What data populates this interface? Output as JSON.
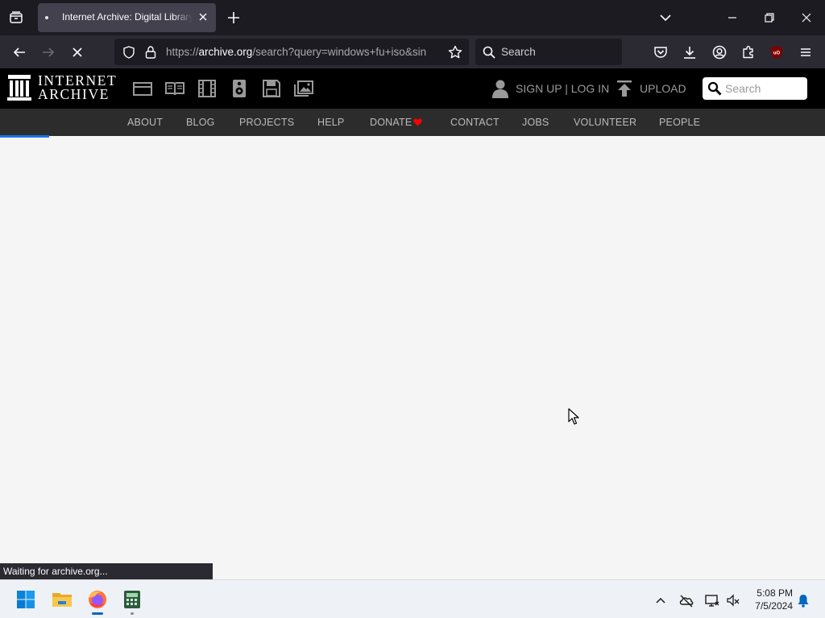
{
  "browser": {
    "tab_title": "Internet Archive: Digital Library of Free & Borrowable Books, Movies, Music & Wayback Machine",
    "url_prefix": "https://",
    "url_host": "archive.org",
    "url_rest": "/search?query=windows+fu+iso&sin",
    "search_placeholder": "Search",
    "status_text": "Waiting for archive.org...",
    "page_loading": true
  },
  "ia": {
    "logo_line1": "INTERNET",
    "logo_line2": "ARCHIVE",
    "signup_label": "SIGN UP | LOG IN",
    "upload_label": "UPLOAD",
    "search_placeholder": "Search",
    "nav": [
      "ABOUT",
      "BLOG",
      "PROJECTS",
      "HELP",
      "DONATE",
      "CONTACT",
      "JOBS",
      "VOLUNTEER",
      "PEOPLE"
    ],
    "donate_heart_color": "#ff0000"
  },
  "taskbar": {
    "time": "5:08 PM",
    "date": "7/5/2024"
  },
  "colors": {
    "tab_strip": "#1c1b22",
    "toolbar": "#2b2a33",
    "ia_header": "#000000",
    "ia_subnav": "#2c2c2c",
    "progress": "#1a73e8"
  }
}
